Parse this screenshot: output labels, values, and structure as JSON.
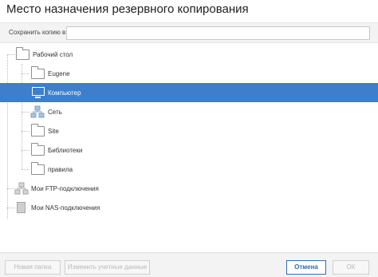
{
  "dialog": {
    "title": "Место назначения резервного копирования"
  },
  "save_to": {
    "label": "Сохранить копию в:",
    "value": ""
  },
  "tree": {
    "desktop": "Рабочий стол",
    "eugene": "Eugene",
    "computer": "Компьютер",
    "network": "Сеть",
    "site": "Site",
    "libraries": "Библиотеки",
    "rules": "правила",
    "ftp": "Мои FTP-подключения",
    "nas": "Мои NAS-подключения"
  },
  "buttons": {
    "new_folder": "Новая папка",
    "edit_credentials": "Изменить учетные данные",
    "cancel": "Отмена",
    "ok": "ОК"
  },
  "colors": {
    "selection": "#3d7fcb",
    "accent": "#2f6db5"
  }
}
